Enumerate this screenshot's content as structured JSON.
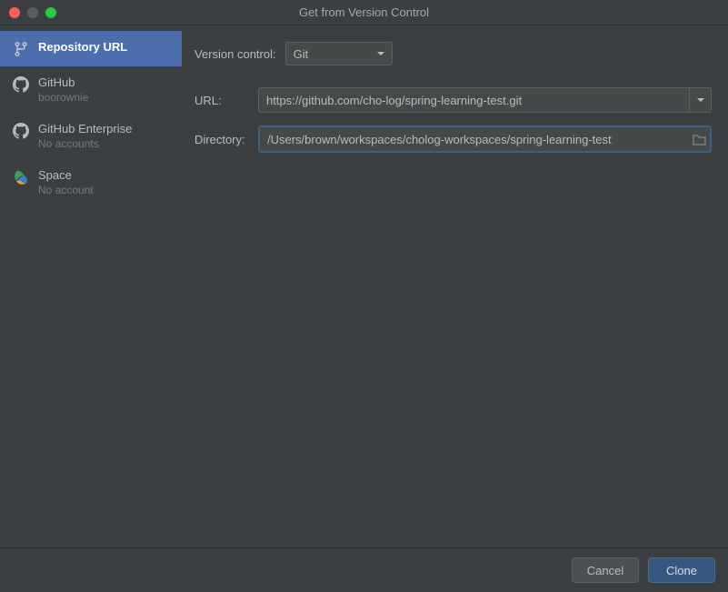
{
  "window": {
    "title": "Get from Version Control"
  },
  "sidebar": {
    "items": [
      {
        "label": "Repository URL",
        "sub": ""
      },
      {
        "label": "GitHub",
        "sub": "boorownie"
      },
      {
        "label": "GitHub Enterprise",
        "sub": "No accounts"
      },
      {
        "label": "Space",
        "sub": "No account"
      }
    ]
  },
  "form": {
    "version_control_label": "Version control:",
    "version_control_value": "Git",
    "url_label": "URL:",
    "url_value": "https://github.com/cho-log/spring-learning-test.git",
    "directory_label": "Directory:",
    "directory_value": "/Users/brown/workspaces/cholog-workspaces/spring-learning-test"
  },
  "footer": {
    "cancel": "Cancel",
    "clone": "Clone"
  }
}
